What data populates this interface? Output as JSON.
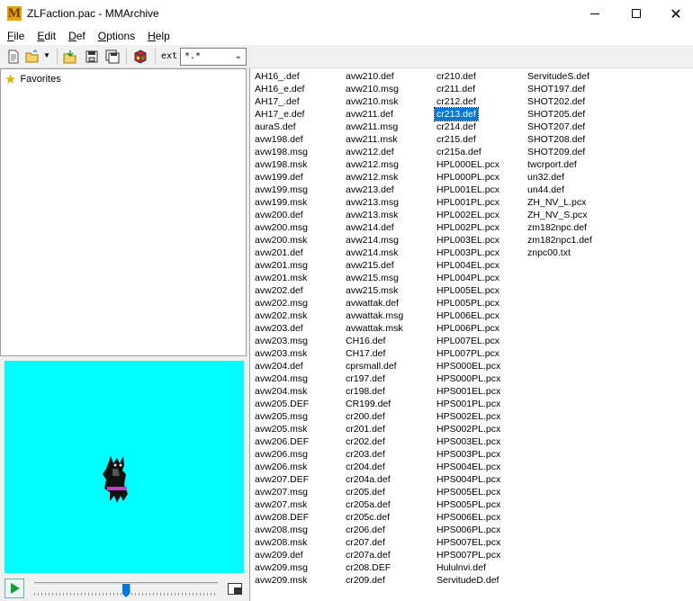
{
  "window": {
    "title": "ZLFaction.pac - MMArchive",
    "app_icon_letter": "M",
    "minimize": "—",
    "maximize": "☐",
    "close": "✕"
  },
  "menu": [
    {
      "label": "File",
      "key": "F",
      "rest": "ile"
    },
    {
      "label": "Edit",
      "key": "E",
      "rest": "dit"
    },
    {
      "label": "Def",
      "key": "D",
      "rest": "ef"
    },
    {
      "label": "Options",
      "key": "O",
      "rest": "ptions"
    },
    {
      "label": "Help",
      "key": "H",
      "rest": "elp"
    }
  ],
  "toolbar": {
    "ext_label": "ext",
    "ext_value": "*.*"
  },
  "tree": {
    "favorites_label": "Favorites"
  },
  "accent_color": "#0078d7",
  "preview_background": "#00ffff",
  "player": {
    "slider_position": 0.5
  },
  "files": {
    "columns": [
      [
        "AH16_.def",
        "AH16_e.def",
        "AH17_.def",
        "AH17_e.def",
        "auraS.def",
        "avw198.def",
        "avw198.msg",
        "avw198.msk",
        "avw199.def",
        "avw199.msg",
        "avw199.msk",
        "avw200.def",
        "avw200.msg",
        "avw200.msk",
        "avw201.def",
        "avw201.msg",
        "avw201.msk",
        "avw202.def",
        "avw202.msg",
        "avw202.msk",
        "avw203.def",
        "avw203.msg",
        "avw203.msk",
        "avw204.def",
        "avw204.msg",
        "avw204.msk",
        "avw205.DEF",
        "avw205.msg",
        "avw205.msk",
        "avw206.DEF",
        "avw206.msg",
        "avw206.msk",
        "avw207.DEF",
        "avw207.msg",
        "avw207.msk",
        "avw208.DEF",
        "avw208.msg",
        "avw208.msk",
        "avw209.def",
        "avw209.msg",
        "avw209.msk"
      ],
      [
        "avw210.def",
        "avw210.msg",
        "avw210.msk",
        "avw211.def",
        "avw211.msg",
        "avw211.msk",
        "avw212.def",
        "avw212.msg",
        "avw212.msk",
        "avw213.def",
        "avw213.msg",
        "avw213.msk",
        "avw214.def",
        "avw214.msg",
        "avw214.msk",
        "avw215.def",
        "avw215.msg",
        "avw215.msk",
        "avwattak.def",
        "avwattak.msg",
        "avwattak.msk",
        "CH16.def",
        "CH17.def",
        "cprsmall.def",
        "cr197.def",
        "cr198.def",
        "CR199.def",
        "cr200.def",
        "cr201.def",
        "cr202.def",
        "cr203.def",
        "cr204.def",
        "cr204a.def",
        "cr205.def",
        "cr205a.def",
        "cr205c.def",
        "cr206.def",
        "cr207.def",
        "cr207a.def",
        "cr208.DEF",
        "cr209.def"
      ],
      [
        "cr210.def",
        "cr211.def",
        "cr212.def",
        "cr213.def",
        "cr214.def",
        "cr215.def",
        "cr215a.def",
        "HPL000EL.pcx",
        "HPL000PL.pcx",
        "HPL001EL.pcx",
        "HPL001PL.pcx",
        "HPL002EL.pcx",
        "HPL002PL.pcx",
        "HPL003EL.pcx",
        "HPL003PL.pcx",
        "HPL004EL.pcx",
        "HPL004PL.pcx",
        "HPL005EL.pcx",
        "HPL005PL.pcx",
        "HPL006EL.pcx",
        "HPL006PL.pcx",
        "HPL007EL.pcx",
        "HPL007PL.pcx",
        "HPS000EL.pcx",
        "HPS000PL.pcx",
        "HPS001EL.pcx",
        "HPS001PL.pcx",
        "HPS002EL.pcx",
        "HPS002PL.pcx",
        "HPS003EL.pcx",
        "HPS003PL.pcx",
        "HPS004EL.pcx",
        "HPS004PL.pcx",
        "HPS005EL.pcx",
        "HPS005PL.pcx",
        "HPS006EL.pcx",
        "HPS006PL.pcx",
        "HPS007EL.pcx",
        "HPS007PL.pcx",
        "Hululnvi.def",
        "ServitudeD.def"
      ],
      [
        "ServitudeS.def",
        "SHOT197.def",
        "SHOT202.def",
        "SHOT205.def",
        "SHOT207.def",
        "SHOT208.def",
        "SHOT209.def",
        "twcrport.def",
        "un32.def",
        "un44.def",
        "ZH_NV_L.pcx",
        "ZH_NV_S.pcx",
        "zm182npc.def",
        "zm182npc1.def",
        "znpc00.txt"
      ]
    ],
    "selected": "cr213.def"
  }
}
